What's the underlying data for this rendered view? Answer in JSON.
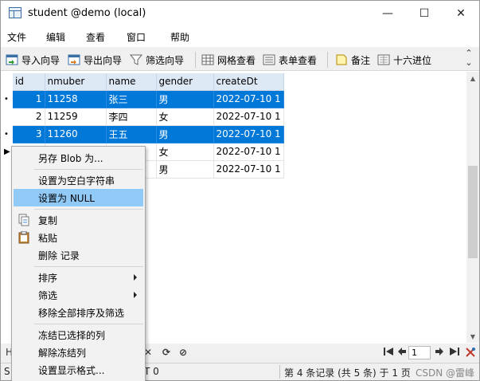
{
  "window": {
    "title": "student @demo (local)",
    "minimize_glyph": "—",
    "maximize_glyph": "☐",
    "close_glyph": "✕"
  },
  "menu": [
    "文件",
    "编辑",
    "查看",
    "窗口",
    "帮助"
  ],
  "toolbar": {
    "import": "导入向导",
    "export": "导出向导",
    "filter": "筛选向导",
    "grid_view": "网格查看",
    "form_view": "表单查看",
    "memo": "备注",
    "hex": "十六进位"
  },
  "table": {
    "columns": [
      "id",
      "nmuber",
      "name",
      "gender",
      "createDt"
    ],
    "rows": [
      {
        "id": "1",
        "nmuber": "11258",
        "name": "张三",
        "gender": "男",
        "createDt": "2022-07-10 1",
        "selected": true,
        "marker": "•"
      },
      {
        "id": "2",
        "nmuber": "11259",
        "name": "李四",
        "gender": "女",
        "createDt": "2022-07-10 1",
        "selected": false,
        "marker": ""
      },
      {
        "id": "3",
        "nmuber": "11260",
        "name": "王五",
        "gender": "男",
        "createDt": "2022-07-10 1",
        "selected": true,
        "marker": "•"
      },
      {
        "id": "",
        "nmuber": "",
        "name": "",
        "gender": "女",
        "createDt": "2022-07-10 1",
        "selected": false,
        "marker": "▶"
      },
      {
        "id": "",
        "nmuber": "",
        "name": "",
        "gender": "男",
        "createDt": "2022-07-10 1",
        "selected": false,
        "marker": ""
      }
    ]
  },
  "context_menu": {
    "save_blob": "另存 Blob 为...",
    "set_empty": "设置为空白字符串",
    "set_null": "设置为 NULL",
    "copy": "复制",
    "paste": "粘贴",
    "delete": "删除 记录",
    "sort": "排序",
    "filter": "筛选",
    "remove_sort_filter": "移除全部排序及筛选",
    "freeze_cols": "冻结已选择的列",
    "unfreeze_cols": "解除冻结列",
    "display_format": "设置显示格式..."
  },
  "navbar": {
    "left_fragment": "H",
    "page_value": "1",
    "close_glyph": "✕",
    "refresh_glyph": "⟳",
    "stop_glyph": "⊘"
  },
  "status": {
    "left_fragment": "S",
    "mid_fragment": "T 0",
    "record_info": "第 4 条记录 (共 5 条) 于 1 页",
    "watermark": "CSDN @雷峰"
  },
  "colors": {
    "selection": "#0078d7",
    "highlight": "#91c9f7",
    "header_bg": "#dde8f5"
  }
}
